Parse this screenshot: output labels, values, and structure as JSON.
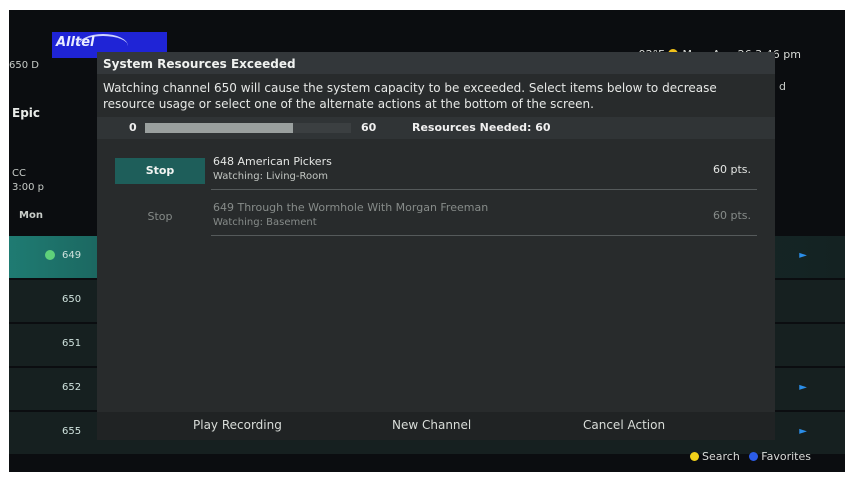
{
  "background": {
    "logo": "Alltel",
    "weather": "92°F",
    "datetime": "Mon, Aug 26 3:46 pm",
    "left_fragments": [
      "650 D",
      "Epic",
      "CC",
      "3:00 p",
      "Mon"
    ],
    "right_fragment": "d",
    "channels": [
      "649",
      "650",
      "651",
      "652",
      "655"
    ],
    "legend": {
      "search": "Search",
      "favorites": "Favorites",
      "search_color": "#f2d21a",
      "favorites_color": "#2b5ce8"
    }
  },
  "dialog": {
    "title": "System Resources Exceeded",
    "message": "Watching channel 650 will cause the system capacity to be exceeded. Select items below to decrease resource usage or select one of the alternate actions at the bottom of the screen.",
    "resources": {
      "min": "0",
      "max": "60",
      "current": "60",
      "fill_fraction": 0.72,
      "needed_label": "Resources Needed: 60"
    },
    "items": [
      {
        "action": "Stop",
        "program": "648 American Pickers",
        "location": "Watching: Living-Room",
        "points": "60 pts.",
        "focused": true
      },
      {
        "action": "Stop",
        "program": "649 Through the Wormhole With Morgan Freeman",
        "location": "Watching: Basement",
        "points": "60 pts.",
        "focused": false
      }
    ],
    "actions": [
      "Play Recording",
      "New Channel",
      "Cancel Action"
    ],
    "accent_color": "#1e5e5a"
  }
}
